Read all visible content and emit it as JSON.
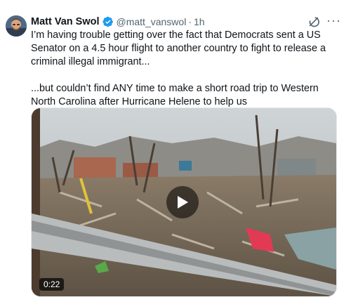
{
  "tweet": {
    "author_name": "Matt Van Swol",
    "handle": "@matt_vanswol",
    "separator": "·",
    "time": "1h",
    "more_label": "···",
    "paragraphs": [
      "I’m having trouble getting over the fact that Democrats sent a US Senator on a 4.5 hour flight to another country to fight to release a criminal illegal immigrant...",
      "...but couldn’t find ANY time to make a short road trip to Western North Carolina after Hurricane Helene to help us"
    ],
    "video": {
      "duration": "0:22"
    }
  },
  "colors": {
    "verified_badge": "#1d9bf0",
    "secondary_text": "#536471",
    "primary_text": "#0f1419"
  },
  "icons": {
    "verified": "verified-badge-icon",
    "grok": "grok-icon",
    "more": "more-icon",
    "play": "play-icon"
  }
}
